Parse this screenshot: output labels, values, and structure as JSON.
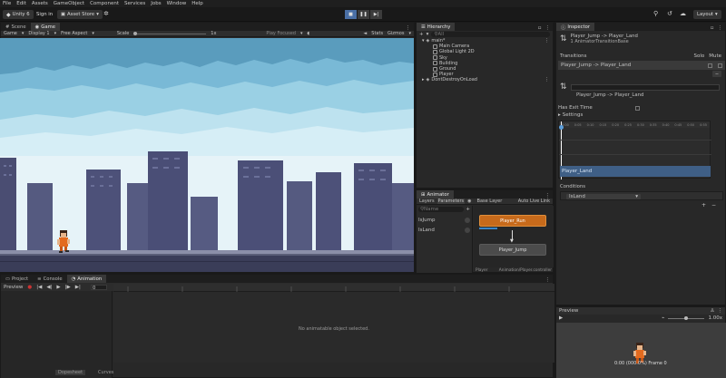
{
  "menu": [
    "File",
    "Edit",
    "Assets",
    "GameObject",
    "Component",
    "Services",
    "Jobs",
    "Window",
    "Help"
  ],
  "toolbar": {
    "account": "Unity 6",
    "sign_in": "Sign in",
    "asset_store": "Asset Store",
    "layout": "Layout"
  },
  "scene_tabs": {
    "scene": "Scene",
    "game": "Game"
  },
  "game_bar": {
    "mode": "Game",
    "display": "Display 1",
    "aspect": "Free Aspect",
    "scale_label": "Scale",
    "scale_value": "1x",
    "play_focused": "Play Focused",
    "stats": "Stats",
    "gizmos": "Gizmos"
  },
  "hierarchy": {
    "title": "Hierarchy",
    "search_placeholder": "All",
    "scene": "main*",
    "items": [
      "Main Camera",
      "Global Light 2D",
      "Sky",
      "Building",
      "Ground",
      "Player"
    ],
    "dont_destroy": "DontDestroyOnLoad"
  },
  "animator": {
    "title": "Animator",
    "tab_layers": "Layers",
    "tab_parameters": "Parameters",
    "base_layer": "Base Layer",
    "auto_live_link": "Auto Live Link",
    "search_placeholder": "Name",
    "parameters": [
      "IsJump",
      "IsLand"
    ],
    "state_run": "Player_Run",
    "state_jump": "Player_Jump",
    "footer_left": "Player",
    "footer_right": "Animation/Player.controller"
  },
  "inspector": {
    "title": "Inspector",
    "transition_title": "Player_Jump -> Player_Land",
    "transition_sub": "1 AnimatorTransitionBase",
    "transitions_label": "Transitions",
    "solo_label": "Solo",
    "mute_label": "Mute",
    "transition_item": "Player_Jump -> Player_Land",
    "transition_name": "Player_Jump -> Player_Land",
    "has_exit_time": "Has Exit Time",
    "settings": "Settings",
    "timeline_ticks": [
      "0:00",
      "0:05",
      "0:10",
      "0:15",
      "0:20",
      "0:25",
      "0:30",
      "0:35",
      "0:40",
      "0:45",
      "0:50",
      "0:55"
    ],
    "land_bar": "Player_Land",
    "conditions": "Conditions",
    "condition_param": "IsLand"
  },
  "preview": {
    "title": "Preview",
    "speed": "1.00x",
    "status": "0:00 (000.0%) Frame 0"
  },
  "bottom_tabs": {
    "project": "Project",
    "console": "Console",
    "animation": "Animation"
  },
  "animation": {
    "preview": "Preview",
    "frame": "0",
    "empty": "No animatable object selected.",
    "dopesheet": "Dopesheet",
    "curves": "Curves"
  }
}
